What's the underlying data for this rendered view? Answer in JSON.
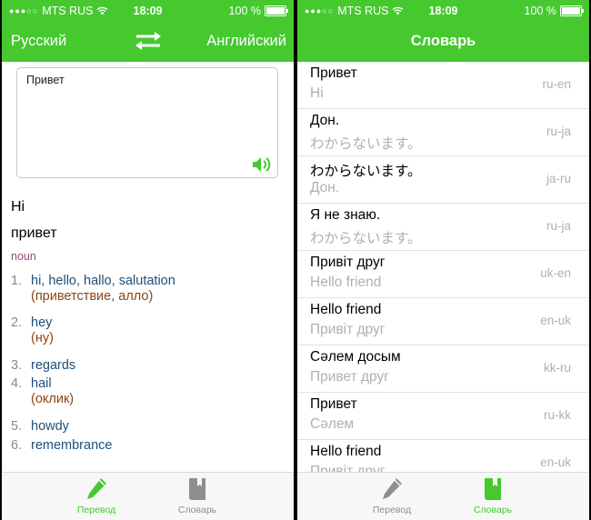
{
  "status_bar": {
    "signal": "●●●○○",
    "carrier": "MTS RUS",
    "time": "18:09",
    "battery": "100 %"
  },
  "translate_screen": {
    "source_lang": "Русский",
    "target_lang": "Английский",
    "input_text": "Привет",
    "result_headword": "Hi",
    "result_query": "привет",
    "part_of_speech": "noun",
    "senses": [
      {
        "num": "1.",
        "translation": "hi, hello, hallo, salutation",
        "examples": "(приветствие, алло)"
      },
      {
        "num": "2.",
        "translation": "hey",
        "examples": "(ну)"
      },
      {
        "num": "3.",
        "translation": "regards",
        "examples": ""
      },
      {
        "num": "4.",
        "translation": "hail",
        "examples": "(оклик)"
      },
      {
        "num": "5.",
        "translation": "howdy",
        "examples": ""
      },
      {
        "num": "6.",
        "translation": "remembrance",
        "examples": ""
      }
    ]
  },
  "dictionary_screen": {
    "title": "Словарь",
    "items": [
      {
        "source": "Привет",
        "translation": "Hi",
        "pair": "ru-en"
      },
      {
        "source": "Дон.",
        "translation": "わからないます。",
        "pair": "ru-ja"
      },
      {
        "source": "わからないます。",
        "translation": "Дон.",
        "pair": "ja-ru"
      },
      {
        "source": "Я не знаю.",
        "translation": "わからないます。",
        "pair": "ru-ja"
      },
      {
        "source": "Привіт друг",
        "translation": "Hello friend",
        "pair": "uk-en"
      },
      {
        "source": "Hello friend",
        "translation": "Привіт друг",
        "pair": "en-uk"
      },
      {
        "source": "Сәлем досым",
        "translation": "Привет друг",
        "pair": "kk-ru"
      },
      {
        "source": "Привет",
        "translation": "Сәлем",
        "pair": "ru-kk"
      },
      {
        "source": "Hello friend",
        "translation": "Привіт друг",
        "pair": "en-uk"
      }
    ]
  },
  "tabs": {
    "translate": "Перевод",
    "dictionary": "Словарь"
  },
  "colors": {
    "accent": "#45c92f",
    "inactive": "#8e8e8e"
  }
}
